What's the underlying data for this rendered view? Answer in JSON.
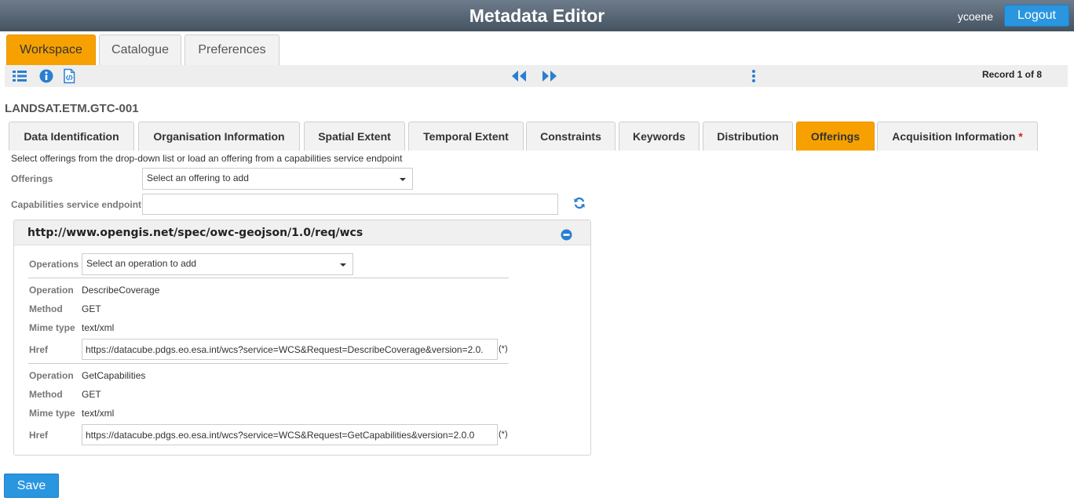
{
  "header": {
    "title": "Metadata Editor",
    "username": "ycoene",
    "logout_label": "Logout"
  },
  "main_tabs": [
    {
      "label": "Workspace",
      "active": true
    },
    {
      "label": "Catalogue",
      "active": false
    },
    {
      "label": "Preferences",
      "active": false
    }
  ],
  "toolbar": {
    "icons": [
      "list-icon",
      "info-icon",
      "xml-file-icon",
      "previous-icon",
      "next-icon",
      "more-vertical-icon"
    ],
    "record_status": "Record 1 of 8"
  },
  "record": {
    "title": "LANDSAT.ETM.GTC-001"
  },
  "section_tabs": [
    {
      "label": "Data Identification"
    },
    {
      "label": "Organisation Information"
    },
    {
      "label": "Spatial Extent"
    },
    {
      "label": "Temporal Extent"
    },
    {
      "label": "Constraints"
    },
    {
      "label": "Keywords"
    },
    {
      "label": "Distribution"
    },
    {
      "label": "Offerings",
      "active": true
    },
    {
      "label": "Acquisition Information",
      "required_marker": "*"
    }
  ],
  "offerings": {
    "help_text": "Select offerings from the drop-down list or load an offering from a capabilities service endpoint",
    "offerings_label": "Offerings",
    "offerings_placeholder": "Select an offering to add",
    "endpoint_label": "Capabilities service endpoint",
    "endpoint_value": ""
  },
  "offering_panel": {
    "title": "http://www.opengis.net/spec/owc-geojson/1.0/req/wcs",
    "operations_label": "Operations",
    "operations_placeholder": "Select an operation to add",
    "labels": {
      "operation": "Operation",
      "method": "Method",
      "mime_type": "Mime type",
      "href": "Href"
    },
    "required_marker": "(*)",
    "operations": [
      {
        "operation": "DescribeCoverage",
        "method": "GET",
        "mime_type": "text/xml",
        "href": "https://datacube.pdgs.eo.esa.int/wcs?service=WCS&Request=DescribeCoverage&version=2.0."
      },
      {
        "operation": "GetCapabilities",
        "method": "GET",
        "mime_type": "text/xml",
        "href": "https://datacube.pdgs.eo.esa.int/wcs?service=WCS&Request=GetCapabilities&version=2.0.0"
      }
    ]
  },
  "actions": {
    "save_label": "Save"
  },
  "colors": {
    "accent_orange": "#f7a100",
    "primary_blue": "#2a96e0",
    "header_dark": "#4f5c69",
    "required_red": "#d9230f"
  }
}
